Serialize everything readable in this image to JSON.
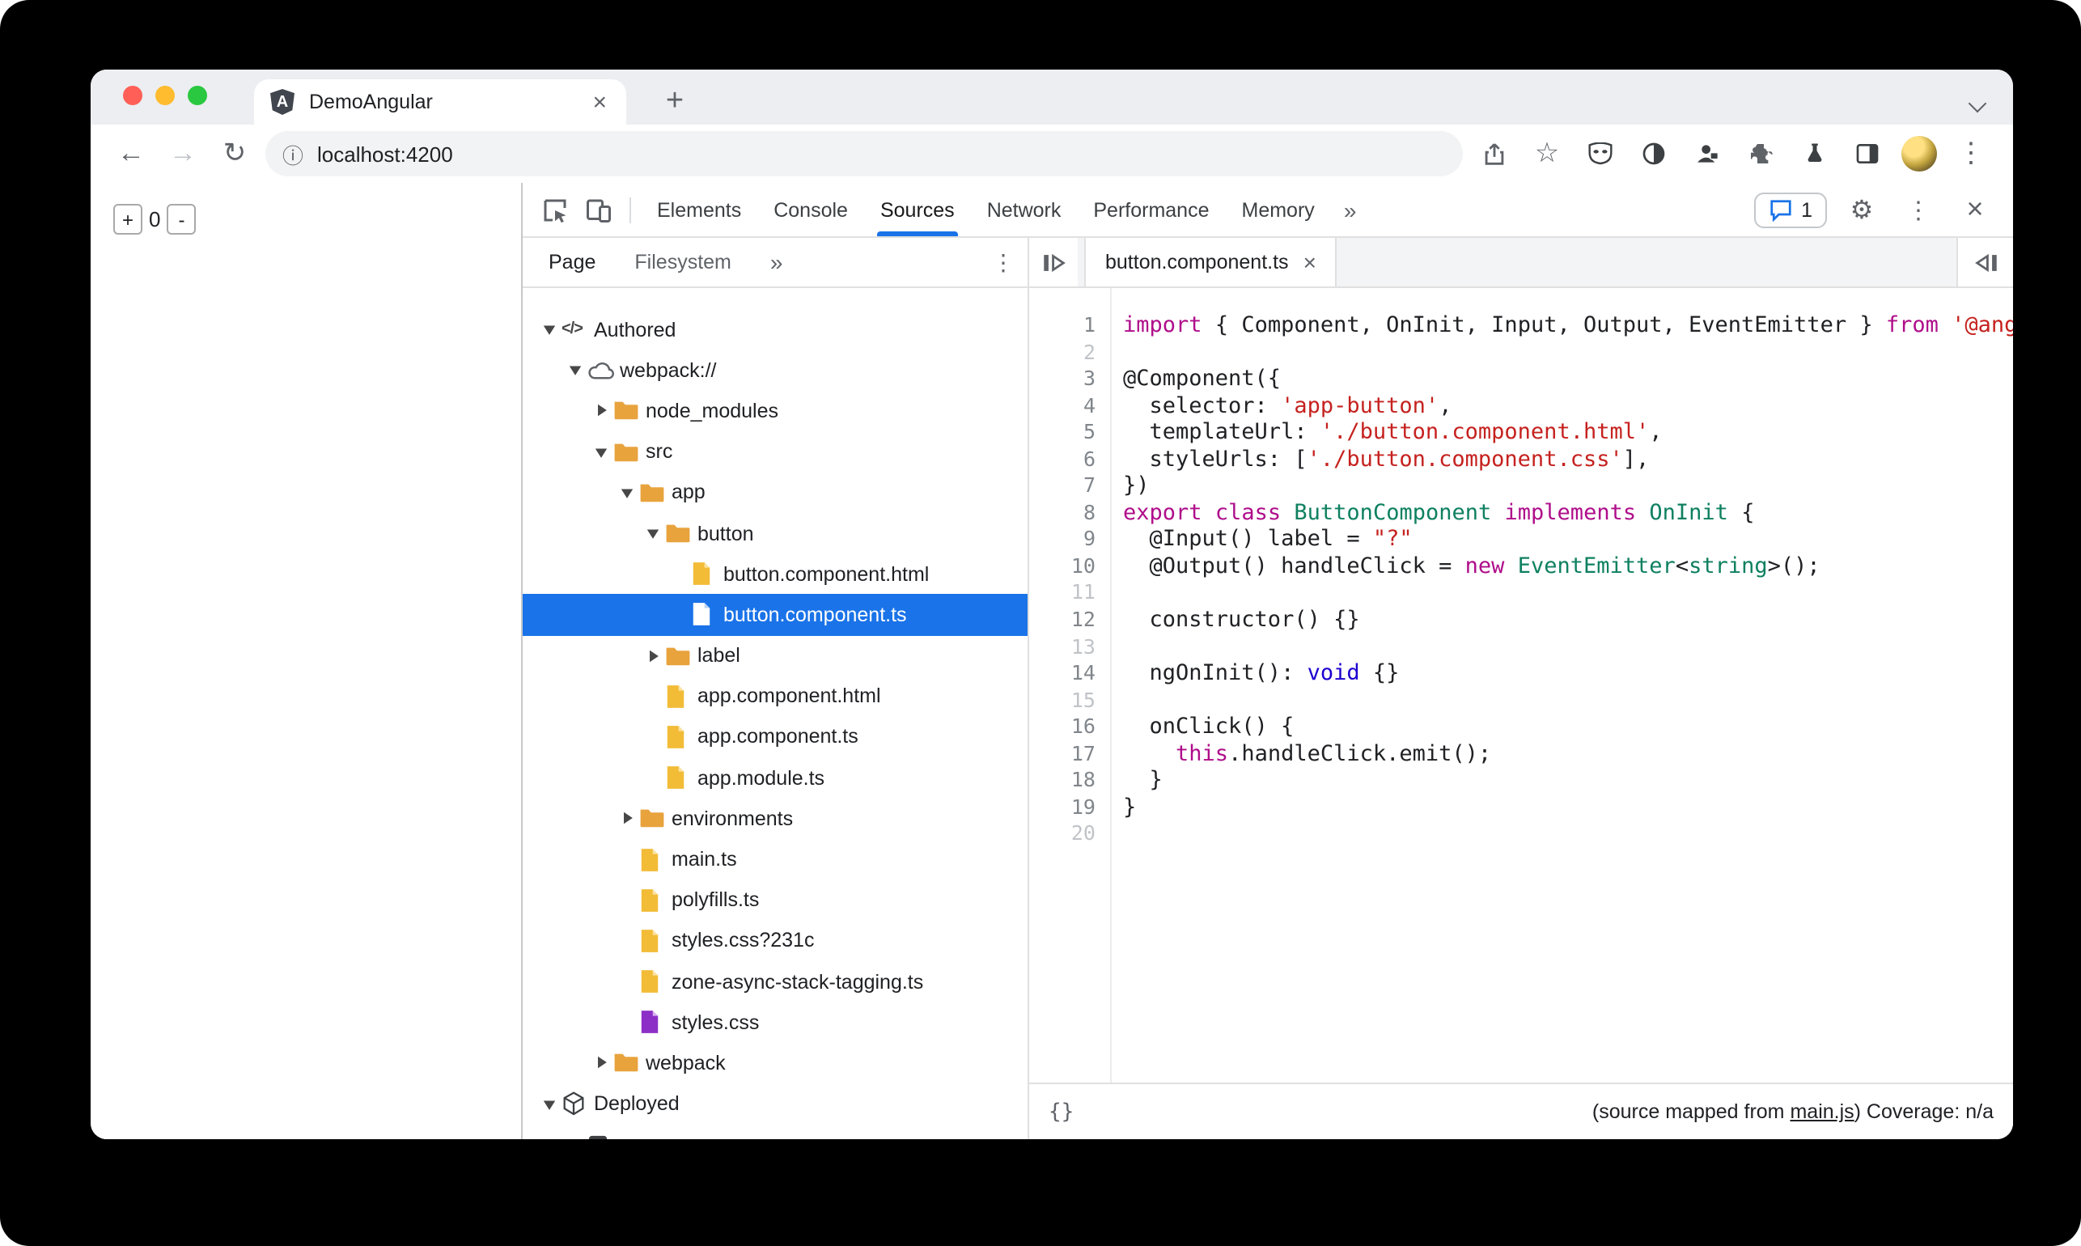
{
  "palette": {
    "accent": "#1a73e8",
    "selection_bg": "#1a73e8",
    "keyword": "#af0d8a",
    "string": "#c5221f",
    "type": "#0e8060",
    "atom": "#1c00cf",
    "plain": "#202124",
    "folder": "#e8a33d",
    "file": "#f2bc37",
    "file_fold": "#fbe3a3",
    "file_css": "#8c2fc7"
  },
  "window": {
    "tab_title": "DemoAngular",
    "favicon_letter": "A",
    "url": "localhost:4200"
  },
  "page": {
    "plus": "+",
    "count": "0",
    "minus": "-"
  },
  "icons": {
    "glyphs": {
      "back": "←",
      "forward": "→",
      "reload": "↻",
      "info": "ⓘ",
      "star": "☆",
      "more": "»",
      "kebab": "⋮",
      "gear": "⚙",
      "close": "×",
      "close_big": "×",
      "plus": "+",
      "braces": "{}"
    },
    "svg_icons": [
      "inspect-element-icon",
      "device-toolbar-icon",
      "share-icon",
      "mask-icon",
      "contrast-icon",
      "profile-lock-icon",
      "puzzle-icon",
      "flask-icon",
      "side-panel-icon",
      "chat-bubble-icon",
      "hide-navigator-icon",
      "show-sidebar-icon",
      "cloud-icon",
      "folder-icon",
      "file-icon",
      "cube-icon",
      "code-icon"
    ]
  },
  "devtools": {
    "tabs": [
      {
        "label": "Elements",
        "selected": false
      },
      {
        "label": "Console",
        "selected": false
      },
      {
        "label": "Sources",
        "selected": true
      },
      {
        "label": "Network",
        "selected": false
      },
      {
        "label": "Performance",
        "selected": false
      },
      {
        "label": "Memory",
        "selected": false
      }
    ],
    "more": "»",
    "message_count": "1",
    "nav_tabs": [
      {
        "label": "Page",
        "selected": true
      },
      {
        "label": "Filesystem",
        "selected": false
      }
    ],
    "nav_more": "»",
    "editor_tab": "button.component.ts",
    "status": {
      "pretty_print": "{}",
      "prefix": "(source mapped from ",
      "link": "main.js",
      "suffix": ") Coverage: n/a"
    }
  },
  "tree": [
    {
      "label": "Authored",
      "depth": 0,
      "icon": "code",
      "expand": "open"
    },
    {
      "label": "webpack://",
      "depth": 1,
      "icon": "cloud",
      "expand": "open"
    },
    {
      "label": "node_modules",
      "depth": 2,
      "icon": "folder",
      "expand": "closed"
    },
    {
      "label": "src",
      "depth": 2,
      "icon": "folder",
      "expand": "open"
    },
    {
      "label": "app",
      "depth": 3,
      "icon": "folder",
      "expand": "open"
    },
    {
      "label": "button",
      "depth": 4,
      "icon": "folder",
      "expand": "open"
    },
    {
      "label": "button.component.html",
      "depth": 5,
      "icon": "file"
    },
    {
      "label": "button.component.ts",
      "depth": 5,
      "icon": "file",
      "selected": true
    },
    {
      "label": "label",
      "depth": 4,
      "icon": "folder",
      "expand": "closed"
    },
    {
      "label": "app.component.html",
      "depth": 4,
      "icon": "file"
    },
    {
      "label": "app.component.ts",
      "depth": 4,
      "icon": "file"
    },
    {
      "label": "app.module.ts",
      "depth": 4,
      "icon": "file"
    },
    {
      "label": "environments",
      "depth": 3,
      "icon": "folder",
      "expand": "closed"
    },
    {
      "label": "main.ts",
      "depth": 3,
      "icon": "file"
    },
    {
      "label": "polyfills.ts",
      "depth": 3,
      "icon": "file"
    },
    {
      "label": "styles.css?231c",
      "depth": 3,
      "icon": "file"
    },
    {
      "label": "zone-async-stack-tagging.ts",
      "depth": 3,
      "icon": "file"
    },
    {
      "label": "styles.css",
      "depth": 3,
      "icon": "css"
    },
    {
      "label": "webpack",
      "depth": 2,
      "icon": "folder",
      "expand": "closed"
    },
    {
      "label": "Deployed",
      "depth": 0,
      "icon": "cube",
      "expand": "open"
    },
    {
      "label": "",
      "depth": 1,
      "icon": "dark",
      "partial": true
    }
  ],
  "code": {
    "lines": [
      {
        "n": 1,
        "segs": [
          [
            "k",
            "import"
          ],
          [
            "p",
            " { Component, OnInit, Input, Output, EventEmitter } "
          ],
          [
            "k",
            "from"
          ],
          [
            "p",
            " "
          ],
          [
            "s",
            "'@angular/core';"
          ]
        ]
      },
      {
        "n": 2,
        "segs": []
      },
      {
        "n": 3,
        "segs": [
          [
            "p",
            "@Component({"
          ]
        ]
      },
      {
        "n": 4,
        "segs": [
          [
            "p",
            "  selector: "
          ],
          [
            "s",
            "'app-button'"
          ],
          [
            "p",
            ","
          ]
        ]
      },
      {
        "n": 5,
        "segs": [
          [
            "p",
            "  templateUrl: "
          ],
          [
            "s",
            "'./button.component.html'"
          ],
          [
            "p",
            ","
          ]
        ]
      },
      {
        "n": 6,
        "segs": [
          [
            "p",
            "  styleUrls: ["
          ],
          [
            "s",
            "'./button.component.css'"
          ],
          [
            "p",
            "],"
          ]
        ]
      },
      {
        "n": 7,
        "segs": [
          [
            "p",
            "})"
          ]
        ]
      },
      {
        "n": 8,
        "segs": [
          [
            "k",
            "export"
          ],
          [
            "p",
            " "
          ],
          [
            "k",
            "class"
          ],
          [
            "p",
            " "
          ],
          [
            "t",
            "ButtonComponent"
          ],
          [
            "p",
            " "
          ],
          [
            "k",
            "implements"
          ],
          [
            "p",
            " "
          ],
          [
            "t",
            "OnInit"
          ],
          [
            "p",
            " {"
          ]
        ]
      },
      {
        "n": 9,
        "segs": [
          [
            "p",
            "  @Input() label = "
          ],
          [
            "s",
            "\"?\""
          ]
        ]
      },
      {
        "n": 10,
        "segs": [
          [
            "p",
            "  @Output() handleClick = "
          ],
          [
            "k",
            "new"
          ],
          [
            "p",
            " "
          ],
          [
            "t",
            "EventEmitter"
          ],
          [
            "p",
            "<"
          ],
          [
            "t",
            "string"
          ],
          [
            "p",
            ">();"
          ]
        ]
      },
      {
        "n": 11,
        "segs": []
      },
      {
        "n": 12,
        "segs": [
          [
            "p",
            "  constructor() {}"
          ]
        ]
      },
      {
        "n": 13,
        "segs": []
      },
      {
        "n": 14,
        "segs": [
          [
            "p",
            "  ngOnInit(): "
          ],
          [
            "a",
            "void"
          ],
          [
            "p",
            " {}"
          ]
        ]
      },
      {
        "n": 15,
        "segs": []
      },
      {
        "n": 16,
        "segs": [
          [
            "p",
            "  onClick() {"
          ]
        ]
      },
      {
        "n": 17,
        "segs": [
          [
            "p",
            "    "
          ],
          [
            "k",
            "this"
          ],
          [
            "p",
            ".handleClick.emit();"
          ]
        ]
      },
      {
        "n": 18,
        "segs": [
          [
            "p",
            "  }"
          ]
        ]
      },
      {
        "n": 19,
        "segs": [
          [
            "p",
            "}"
          ]
        ]
      },
      {
        "n": 20,
        "segs": []
      }
    ]
  }
}
